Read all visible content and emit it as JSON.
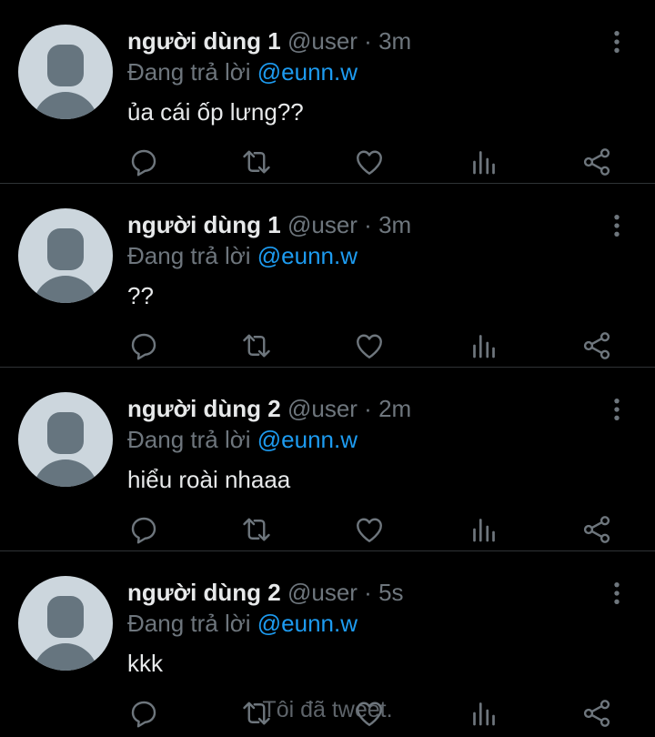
{
  "tweets": [
    {
      "name": "người dùng 1",
      "handle": "@user",
      "sep": " · ",
      "time": "3m",
      "reply_prefix": "Đang trả lời ",
      "reply_to": "@eunn.w",
      "text": "ủa cái ốp lưng??"
    },
    {
      "name": "người dùng 1",
      "handle": "@user",
      "sep": " · ",
      "time": "3m",
      "reply_prefix": "Đang trả lời ",
      "reply_to": "@eunn.w",
      "text": "??"
    },
    {
      "name": "người dùng 2",
      "handle": "@user",
      "sep": " · ",
      "time": "2m",
      "reply_prefix": "Đang trả lời ",
      "reply_to": "@eunn.w",
      "text": "hiểu roài nhaaa"
    },
    {
      "name": "người dùng 2",
      "handle": "@user",
      "sep": " · ",
      "time": "5s",
      "reply_prefix": "Đang trả lời ",
      "reply_to": "@eunn.w",
      "text": "kkk"
    }
  ],
  "toast": "Tôi đã tweet.",
  "icons": [
    "reply-icon",
    "retweet-icon",
    "like-icon",
    "analytics-icon",
    "share-icon",
    "more-icon"
  ],
  "colors": {
    "background": "#000000",
    "text": "#e7e9ea",
    "muted": "#6e767d",
    "mention": "#1d9bf0",
    "divider": "#2f3336"
  }
}
